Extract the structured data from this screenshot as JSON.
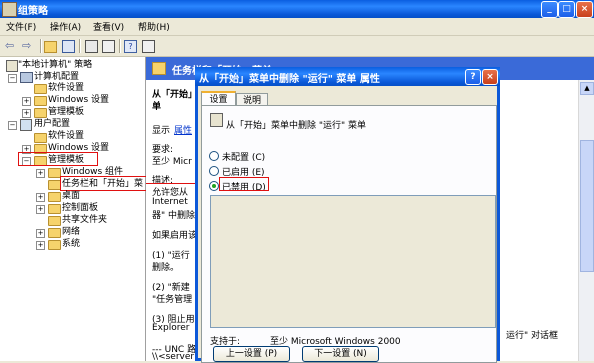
{
  "window": {
    "title": "组策略"
  },
  "menu": [
    "文件(F)",
    "操作(A)",
    "查看(V)",
    "帮助(H)"
  ],
  "tree": {
    "root": "\"本地计算机\" 策略",
    "computer_config": "计算机配置",
    "cc_items": [
      "软件设置",
      "Windows 设置",
      "管理模板"
    ],
    "user_config": "用户配置",
    "uc_items": [
      "软件设置",
      "Windows 设置",
      "管理模板"
    ],
    "admin_items": [
      "Windows 组件",
      "任务栏和「开始」菜",
      "桌面",
      "控制面板",
      "共享文件夹",
      "网络",
      "系统"
    ]
  },
  "right": {
    "header": "任务栏和「开始」菜单",
    "lines": [
      "从「开始」",
      "单",
      "显示",
      "属性",
      "要求:",
      "至少 Micr",
      "描述:",
      "允许您从",
      "Internet",
      "器\" 中删除",
      "如果启用该",
      "(1) \"运行",
      "删除。",
      "(2) \"新建",
      "\"任务管理",
      "(3) 阻止用",
      "Explorer",
      "--- UNC 路径",
      "\\\\<server>"
    ],
    "tail": "运行\" 对话框"
  },
  "dialog": {
    "title": "从「开始」菜单中删除 \"运行\" 菜单 属性",
    "tabs": [
      "设置",
      "说明"
    ],
    "policy_name": "从「开始」菜单中删除 \"运行\" 菜单",
    "options": [
      "未配置 (C)",
      "已启用 (E)",
      "已禁用 (D)"
    ],
    "selected": 2,
    "supported_label": "支持于:",
    "supported_value": "至少 Microsoft Windows 2000",
    "prev_button": "上一设置 (P)",
    "next_button": "下一设置 (N)"
  }
}
